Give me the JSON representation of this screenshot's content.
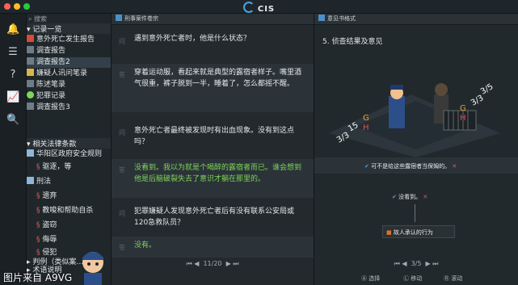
{
  "window": {
    "title": "CIS"
  },
  "sidebar": {
    "search_placeholder": "搜索",
    "records_section": "记录一览",
    "records": [
      "意外死亡发生报告",
      "调查报告",
      "调查报告2",
      "嫌疑人讯问笔录",
      "陈述笔录",
      "犯罪记录",
      "调查报告3"
    ],
    "laws_section": "相关法律条款",
    "law_items": [
      "华阳区政府安全规则",
      "驱逐，等",
      "刑法",
      "遗弃",
      "教唆和帮助自杀",
      "盗窃",
      "侮辱",
      "侵犯",
      "判例（类似案…",
      "术语说明"
    ]
  },
  "middle": {
    "tab": "刑事案件卷宗",
    "dialogue": [
      {
        "text": "遇到意外死亡者时，他是什么状态？",
        "color": "white"
      },
      {
        "text": "穿着运动服，看起来就是典型的露宿者样子。嘴里酒气很重，裤子脱到一半，睡着了，怎么都摇不醒。",
        "color": "mixed"
      },
      {
        "text": "意外死亡者最终被发现时有出血现象。没有到这点吗？",
        "color": "white"
      },
      {
        "text": "没看到。我以为就是个喝醉的露宿者而已。谁会想到他是后脑破裂失去了意识才躺在那里的。",
        "color": "green"
      },
      {
        "text": "犯罪嫌疑人发现意外死亡者后有没有联系公安局或120急救队员？",
        "color": "white"
      },
      {
        "text": "没有。",
        "color": "green"
      }
    ],
    "pager": "11/20"
  },
  "right": {
    "tab": "意见书格式",
    "subtitle": "5. 侦查结果及意见",
    "choice1": "可不是给这些露宿者当保姆的。",
    "choice2": "没看到。",
    "choice3": "故人承认的行为",
    "pager": "3/5",
    "footer": {
      "select": "选择",
      "move": "移动",
      "scroll": "滚动"
    }
  },
  "watermark": "图片来自 A9VG"
}
